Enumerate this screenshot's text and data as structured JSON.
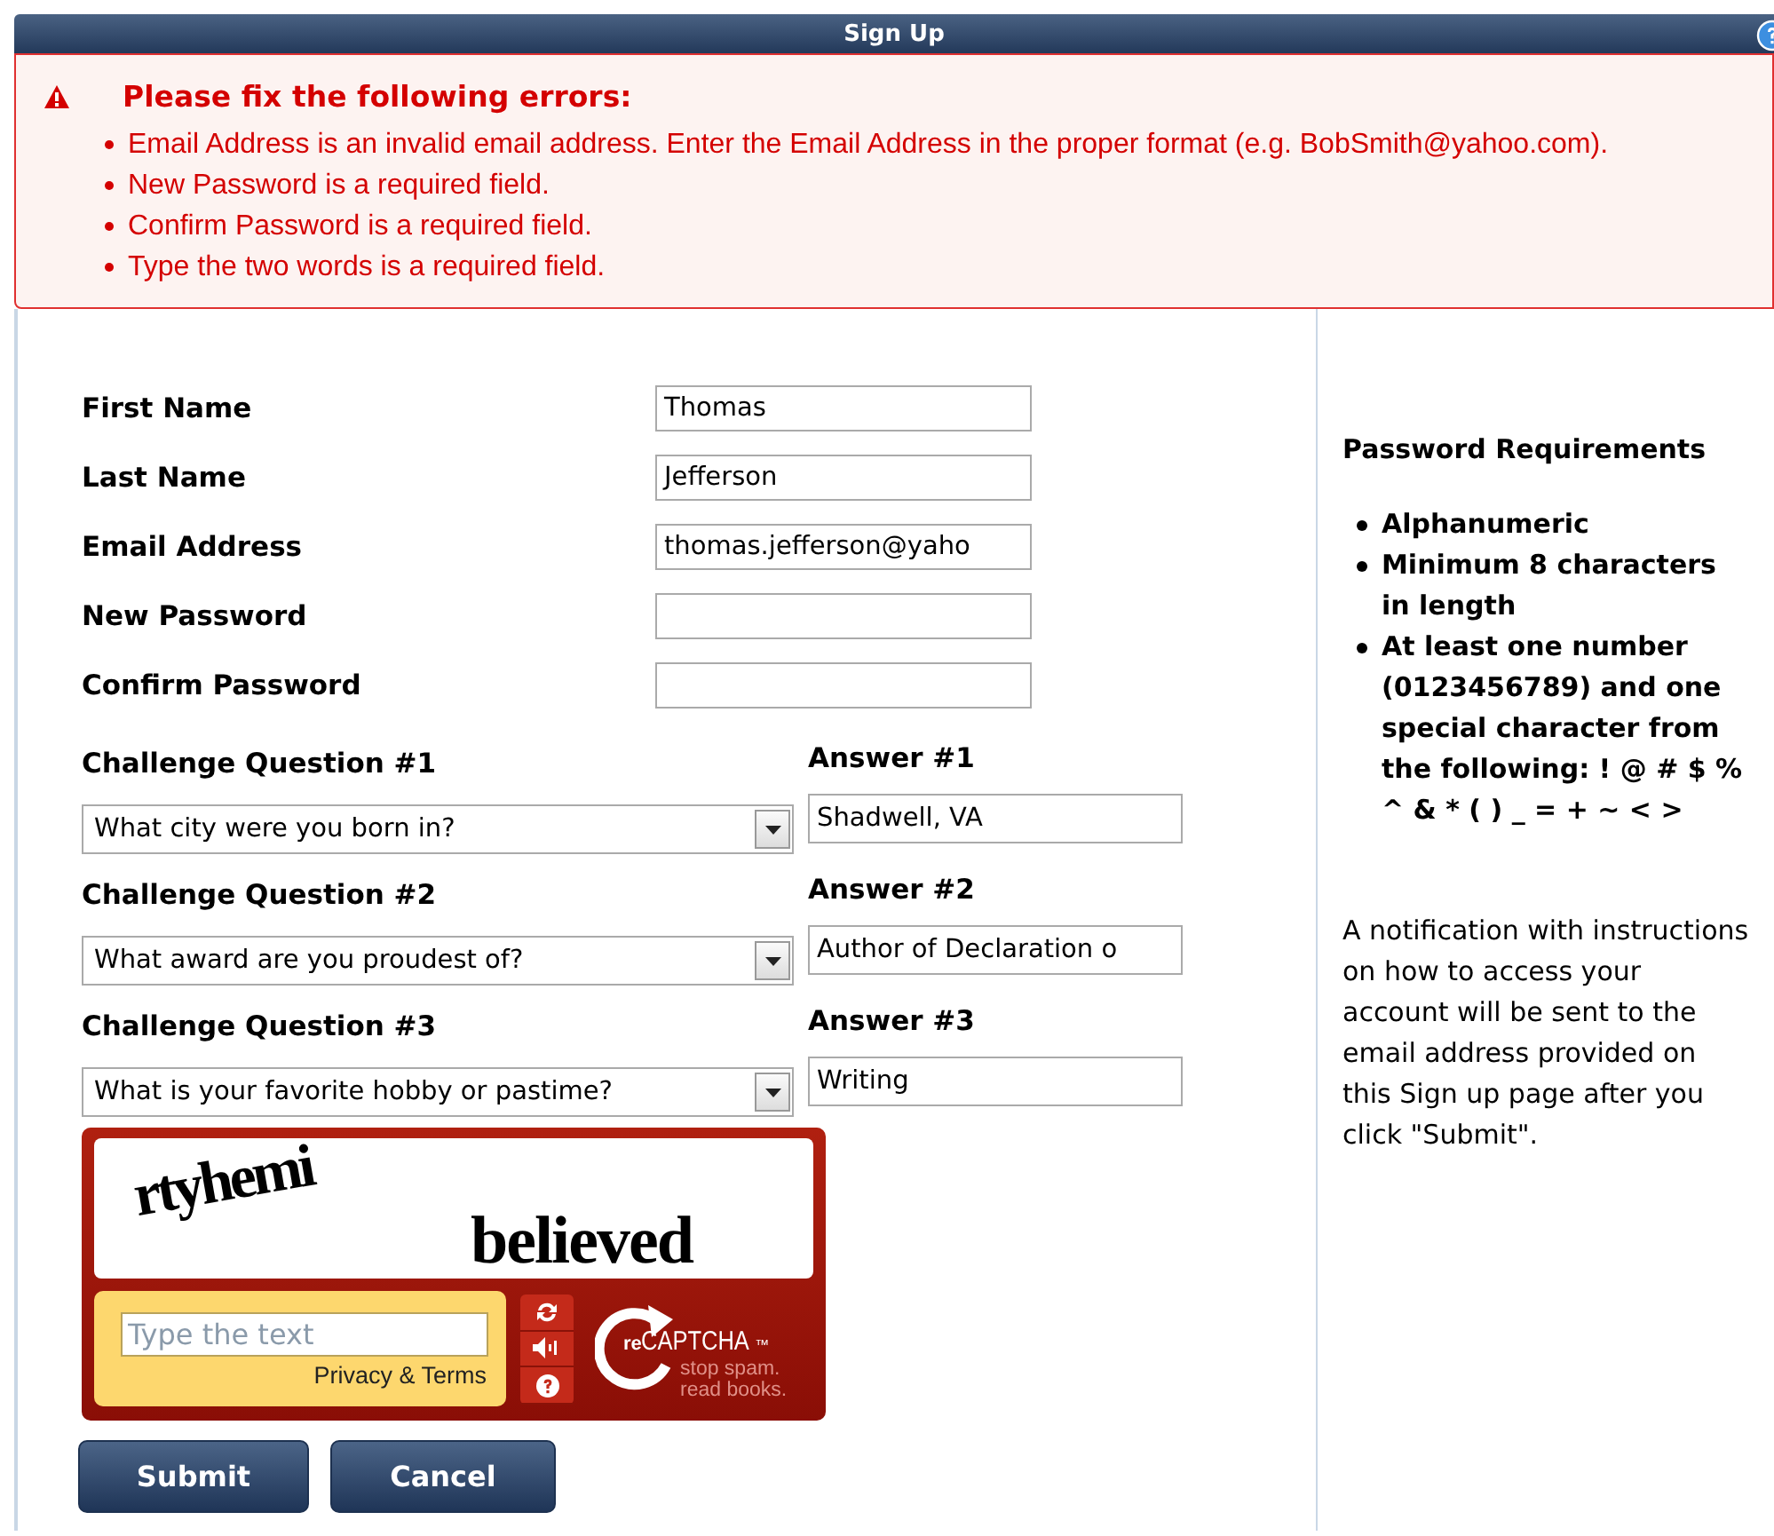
{
  "window": {
    "title": "Sign Up"
  },
  "errors": {
    "heading": "Please fix the following errors:",
    "items": [
      "Email Address is an invalid email address. Enter the Email Address in the proper format (e.g. BobSmith@yahoo.com).",
      "New Password is a required field.",
      "Confirm Password is a required field.",
      "Type the two words is a required field."
    ]
  },
  "fields": [
    {
      "label": "First Name",
      "value": "Thomas"
    },
    {
      "label": "Last Name",
      "value": "Jefferson"
    },
    {
      "label": "Email Address",
      "value": "thomas.jefferson@yaho"
    },
    {
      "label": "New Password"
    },
    {
      "label": "Confirm Password"
    }
  ],
  "challenges": [
    {
      "label": "Challenge Question #1",
      "question": "What city were you born in?",
      "answer_label": "Answer #1",
      "answer": "Shadwell, VA"
    },
    {
      "label": "Challenge Question #2",
      "question": "What award are you proudest of?",
      "answer_label": "Answer #2",
      "answer": "Author of Declaration o"
    },
    {
      "label": "Challenge Question #3",
      "question": "What is your favorite hobby or pastime?",
      "answer_label": "Answer #3",
      "answer": "Writing"
    }
  ],
  "captcha": {
    "words": [
      "rtyhemi",
      "believed"
    ],
    "placeholder": "Type the text",
    "link": "Privacy & Terms",
    "logo_prefix": "re",
    "logo": "CAPTCHA",
    "trademark": "™",
    "tagline": [
      "stop spam.",
      "read books."
    ]
  },
  "buttons": [
    "Submit",
    "Cancel"
  ],
  "sidebar": {
    "heading": "Password Requirements",
    "requirements": [
      "Alphanumeric",
      "Minimum 8 characters in length",
      "At least one number (0123456789) and one special character from the following: ! @ # $ % ^ & * ( ) _ = + ~ < >"
    ],
    "note": "A notification with instructions on how to access your account will be sent to the email address provided on this Sign up page after you click \"Submit\"."
  }
}
